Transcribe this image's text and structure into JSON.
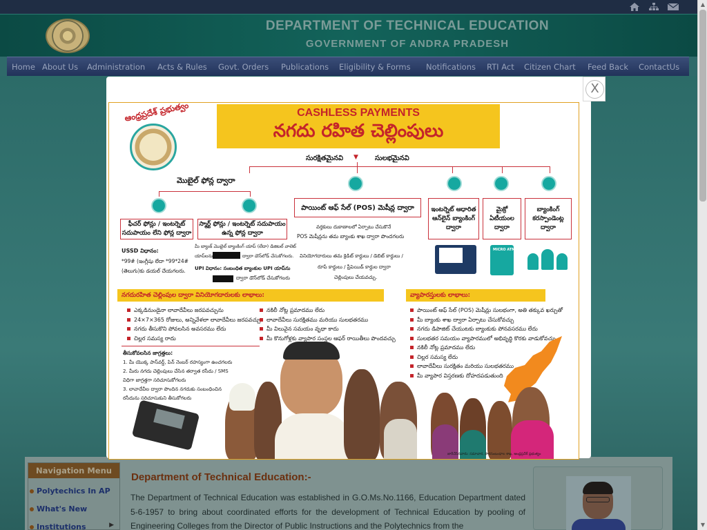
{
  "topbar": {
    "icons": [
      "home-icon",
      "sitemap-icon",
      "mail-icon"
    ]
  },
  "header": {
    "title": "DEPARTMENT OF TECHNICAL EDUCATION",
    "subtitle": "GOVERNMENT OF ANDRA PRADESH"
  },
  "nav": {
    "items": [
      {
        "label": "Home"
      },
      {
        "label": "About Us"
      },
      {
        "label": "Administration"
      },
      {
        "label": "Acts & Rules"
      },
      {
        "label": "Govt. Orders"
      },
      {
        "label": "Publications"
      },
      {
        "label": "Eligibility & Forms"
      },
      {
        "label": "Notifications"
      },
      {
        "label": "RTI Act"
      },
      {
        "label": "Citizen Chart"
      },
      {
        "label": "Feed Back"
      },
      {
        "label": "ContactUs"
      }
    ]
  },
  "popup": {
    "close_label": "X",
    "poster": {
      "seal_caption": "ఆంధ్రప్రదేశ్ ప్రభుత్వం",
      "title_en": "CASHLESS PAYMENTS",
      "title_te": "నగదు రహిత చెల్లింపులు",
      "safe": "సురక్షితమైనవి",
      "easy": "సులభమైనవి",
      "mobile_heading": "మొబైల్ ఫోన్ల ద్వారా",
      "feature_box": "ఫీచర్ ఫోన్లు / ఇంటర్నెట్ సదుపాయం లేని ఫోన్ల ద్వారా",
      "smart_box": "స్మార్ట్ ఫోన్లు / ఇంటర్నెట్ సదుపాయం ఉన్న ఫోన్ల ద్వారా",
      "pos_box": "పాయింట్ ఆఫ్ సేల్ (POS) మెషీన్ల ద్వారా",
      "internet_box": "ఇంటర్నెట్ ఆధారిత ఆన్‌లైన్ బ్యాంకింగ్ ద్వారా",
      "micro_box": "మైక్రో ఏటీయంల ద్వారా",
      "bank_box": "బ్యాంకింగ్ కరస్పాండెంట్ల ద్వారా",
      "ussd_title": "USSD విధానం:",
      "ussd_line1": "*99# (ఇంగ్లీషు లేదా *99*24#",
      "ussd_line2": "(తెలుగు)కు డయల్ చేయగలరు.",
      "smart_line1": "మీ బ్యాంక్ మొబైల్ బ్యాంకింగ్ యాప్ (లేదా) డిజిటల్ వాలెట్",
      "smart_line2": "యాప్‌లను",
      "smart_line3": "ద్వారా డౌన్‌లోడ్ చేసుకోగలరు.",
      "upi_line1": "UPI విధానం: సంబంధిత బ్యాంకుల UPI యాప్‌ను",
      "upi_line2": "ద్వారా డౌన్‌లోడ్ చేసుకోగలరు",
      "pos_text1": "వర్తకులు దుకాణాలలో ఏర్పాటు చేసుకొనే",
      "pos_text2": "POS మెషీన్లను తమ బ్యాంకు శాఖ ద్వారా పొందగలరు",
      "pos_text3": "వినియోగదారులు తమ క్రెడిట్ కార్డులు / డెబిట్ కార్డులు /",
      "pos_text4": "రూపే కార్డులు / ప్రీపెయిడ్ కార్డుల ద్వారా",
      "pos_text5": "చెల్లింపులు చేయవచ్చు.",
      "micro_atm_label": "MICRO ATM",
      "consumer_bar": "నగదురహిత చెల్లింపుల ద్వారా వినియోగదారులకు లాభాలు:",
      "consumer_left": [
        "ఎక్కడినుండైనా లావాదేవీలు జరపవచ్చును",
        "24×7×365 రోజులు, అన్నివేళలా లావాదేవీలు జరపవచ్చు",
        "నగదు తీసుకొని పోవలసిన అవసరము లేదు",
        "చిల్లర సమస్య రాదు"
      ],
      "consumer_right": [
        "నకిలీ నోట్ల ప్రమాదము లేదు",
        "లావాదేవీలు సురక్షితము మరియు సులభతరము",
        "మీ విలువైన సమయం వృధా కాదు",
        "మీ కొనుగోళ్లకు వ్యాపార సంస్థల ఆఫర్ రాయితీలు పొందవచ్చు"
      ],
      "merchant_bar": "వ్యాపారస్తులకు లాభాలు:",
      "merchant_list": [
        "పాయింట్ ఆఫ్ సేల్ (POS) మెషీన్లు సులభంగా, అతి తక్కువ ఖర్చుతో",
        "మీ బ్యాంకు శాఖ ద్వారా ఏర్పాటు చేసుకోవచ్చు",
        "నగదు డిపాజిట్ చేయుటకు బ్యాంకుకు పోనవసరము లేదు",
        "సులభతర సమయం వ్యాపారములో అభివృద్ధి కొరకు వాడుకోవచ్చు",
        "నకిలీ నోట్ల ప్రమాదము లేదు",
        "చిల్లర సమస్య లేదు",
        "లావాదేవీలు సురక్షితం మరియు సులభతరము",
        "మీ వ్యాపార విస్తరణకు దోహదపడుతుంది"
      ],
      "care_title": "తీసుకోవలసిన జాగ్రత్తలు:",
      "care_list": [
        "1. మీ యొక్క పాస్‌వర్డ్, పిన్ నెంబర్ రహస్యంగా ఉంచగలరు",
        "2. మీరు నగదు చెల్లింపులు చేసిన తర్వాత రసీదు / SMS",
        "   విధిగా జాగ్రత్తగా సరిచూసుకోగలరు",
        "3. లావాదేవీల ద్వారా పొందిన నగదుకు సంబంధించిన",
        "   రసీదును సరిచూసుకుని తీసుకోగలరు"
      ],
      "footer_note": "జారీచేసినవారు: సమాచార, పౌరసంబంధాల శాఖ, ఆంధ్రప్రదేశ్ ప్రభుత్వం"
    }
  },
  "sidebar": {
    "heading": "Navigation Menu",
    "items": [
      {
        "label": "Polytechics In AP",
        "has_arrow": false
      },
      {
        "label": "What's New",
        "has_arrow": false
      },
      {
        "label": "Institutions",
        "has_arrow": true
      }
    ]
  },
  "main": {
    "title": "Department of Technical Education:-",
    "paragraph": "The Department of Technical Education was established in G.O.Ms.No.1166, Education Department dated 5-6-1957 to bring about coordinated efforts for the development of Technical Education by pooling of Engineering Colleges from the Director of Public Instructions and the Polytechnics from the"
  },
  "colors": {
    "nav_bg": "#22335a",
    "header_bg": "#13635a",
    "poster_yellow": "#f5c51e",
    "poster_red": "#c4242a",
    "poster_teal": "#16a8a0"
  }
}
